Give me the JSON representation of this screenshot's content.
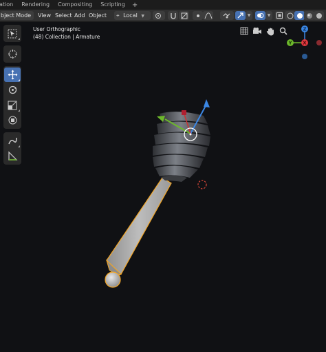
{
  "workspace_tabs": [
    "ation",
    "Rendering",
    "Compositing",
    "Scripting",
    "+"
  ],
  "header": {
    "mode": "bject Mode",
    "menus": [
      "View",
      "Select",
      "Add",
      "Object"
    ],
    "transform_orientation": "Local"
  },
  "toolbar": {
    "tools": [
      "select-box",
      "cursor",
      "move",
      "rotate",
      "scale",
      "transform",
      "annotate",
      "measure"
    ],
    "active_tool": "move"
  },
  "viewport": {
    "view_name": "User Orthographic",
    "collection_info": "(48) Collection | Armature"
  },
  "gizmo": {
    "axes": [
      "X",
      "Y",
      "Z"
    ],
    "colors": {
      "x": "#e0393f",
      "y": "#6db82c",
      "z": "#3b87e4"
    }
  },
  "colors": {
    "accent": "#4772b3",
    "selection": "#f5a623",
    "background": "#101114"
  }
}
